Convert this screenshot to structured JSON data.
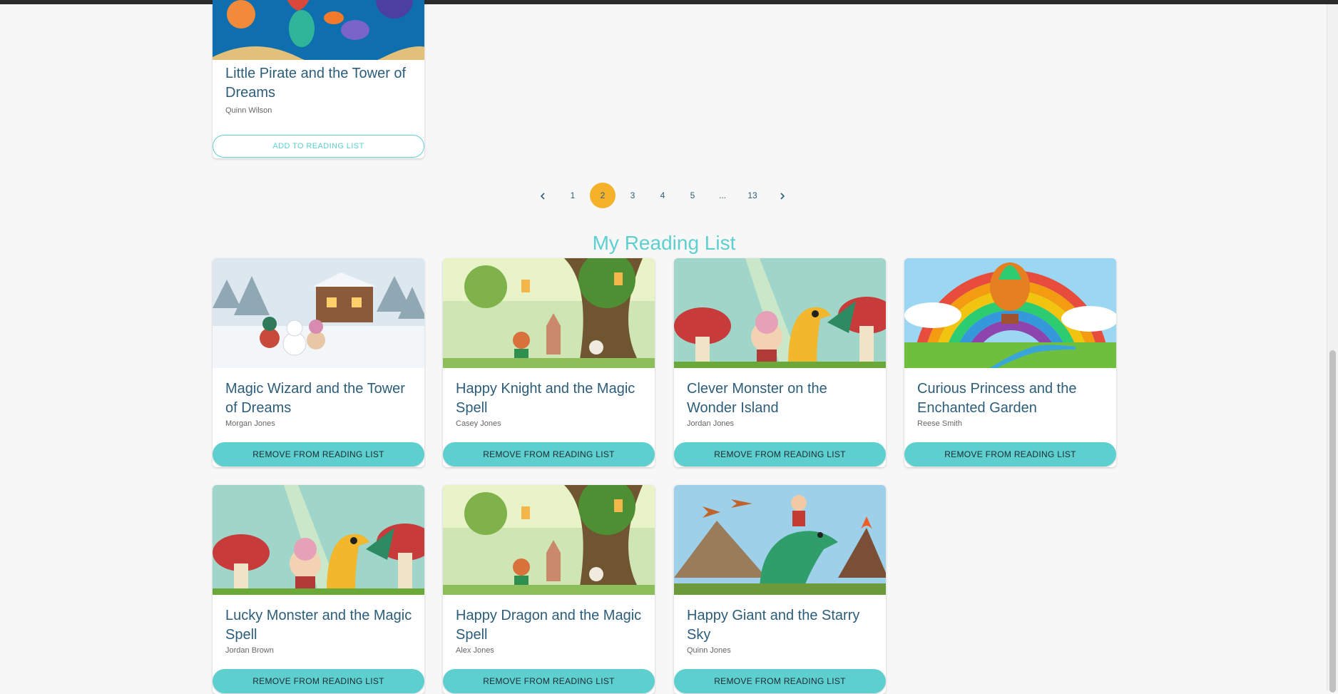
{
  "top_card": {
    "title": "Little Pirate and the Tower of Dreams",
    "author": "Quinn Wilson",
    "button_label": "ADD TO READING LIST"
  },
  "pagination": {
    "prev_icon": "chevron-left",
    "next_icon": "chevron-right",
    "pages": [
      "1",
      "2",
      "3",
      "4",
      "5",
      "...",
      "13"
    ],
    "current": "2"
  },
  "reading_list": {
    "heading": "My Reading List",
    "button_label": "REMOVE FROM READING LIST",
    "books": [
      {
        "title": "Magic Wizard and the Tower of Dreams",
        "author": "Morgan Jones",
        "cover": "winter-cottage"
      },
      {
        "title": "Happy Knight and the Magic Spell",
        "author": "Casey Jones",
        "cover": "fairy-tree"
      },
      {
        "title": "Clever Monster on the Wonder Island",
        "author": "Jordan Jones",
        "cover": "dragon-mushrooms"
      },
      {
        "title": "Curious Princess and the Enchanted Garden",
        "author": "Reese Smith",
        "cover": "rainbow-balloon"
      },
      {
        "title": "Lucky Monster and the Magic Spell",
        "author": "Jordan Brown",
        "cover": "dragon-mushrooms"
      },
      {
        "title": "Happy Dragon and the Magic Spell",
        "author": "Alex Jones",
        "cover": "fairy-tree"
      },
      {
        "title": "Happy Giant and the Starry Sky",
        "author": "Quinn Jones",
        "cover": "dinosaur-volcano"
      }
    ]
  },
  "colors": {
    "accent": "#5ecfcf",
    "active_page": "#f6b12a",
    "title_text": "#2c5d7a",
    "background": "#f7f7f7"
  }
}
